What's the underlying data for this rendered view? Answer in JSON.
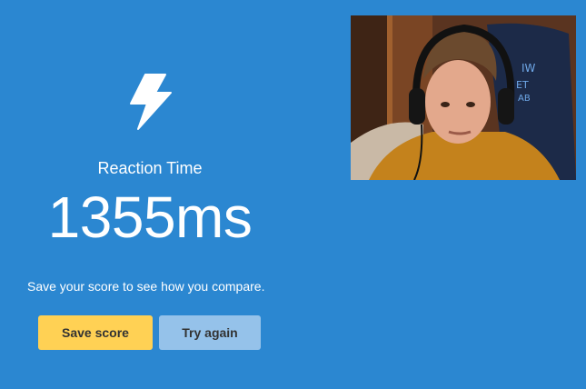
{
  "test": {
    "name": "Reaction Time",
    "result": "1355ms",
    "hint": "Save your score to see how you compare."
  },
  "actions": {
    "save_label": "Save score",
    "retry_label": "Try again"
  },
  "icons": {
    "test_icon": "lightning-bolt-icon"
  },
  "colors": {
    "background": "#2b87d1",
    "save_button": "#ffd154",
    "retry_button": "#95c2ea",
    "text": "#ffffff"
  }
}
